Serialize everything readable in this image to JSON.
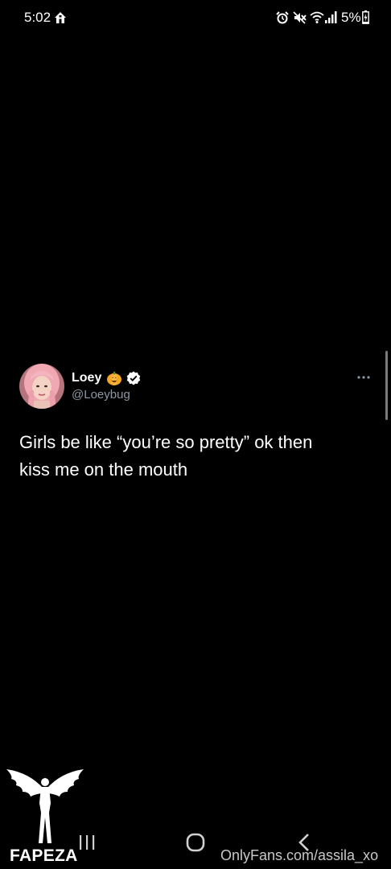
{
  "status_bar": {
    "time": "5:02",
    "battery": "5%",
    "icons": [
      "home-icon",
      "alarm-icon",
      "mute-icon",
      "wifi-icon",
      "signal-icon",
      "battery-charging-icon"
    ]
  },
  "tweet": {
    "display_name": "Loey",
    "name_emoji": "pumpkin-icon",
    "verified": true,
    "handle": "@Loeybug",
    "text_line1": "Girls be like “you’re so pretty” ok then",
    "text_line2": "kiss me on the mouth",
    "more_icon": "more-options-icon"
  },
  "watermark": {
    "brand": "FAPEZA",
    "source": "OnlyFans.com/assila_xo"
  },
  "navigation": {
    "icons": [
      "recents-icon",
      "home-button-icon",
      "back-icon"
    ]
  },
  "colors": {
    "background": "#000000",
    "text": "#ffffff",
    "secondary_text": "#8b98a5",
    "pumpkin": "#f5a623"
  }
}
